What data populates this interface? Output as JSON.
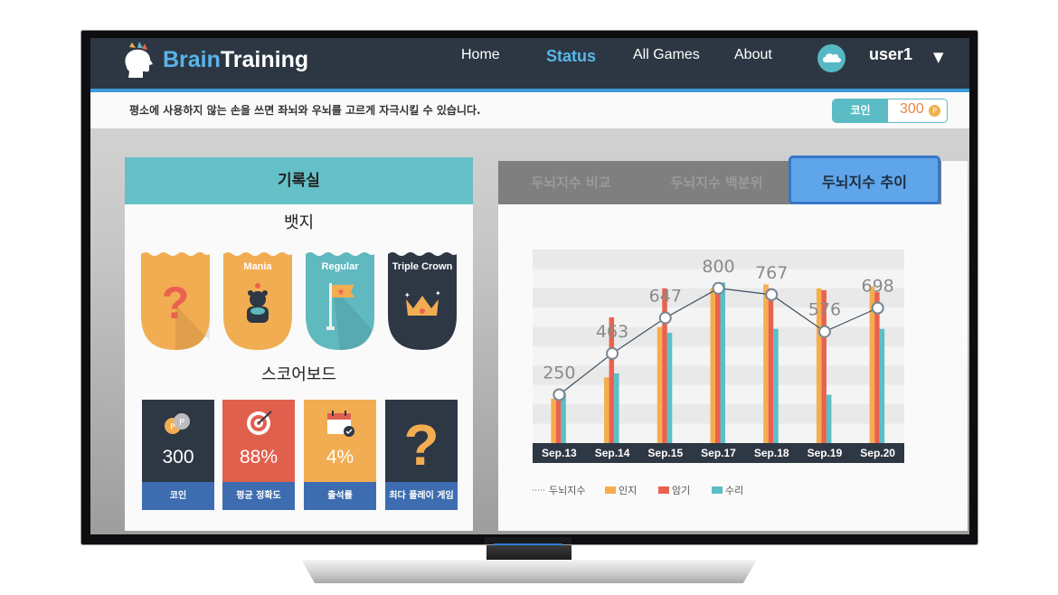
{
  "app": {
    "logo_part1": "Brain",
    "logo_part2": "Training"
  },
  "nav": {
    "items": [
      {
        "label": "Home"
      },
      {
        "label": "Status",
        "active": true
      },
      {
        "label": "All Games"
      },
      {
        "label": "About"
      }
    ],
    "username": "user1",
    "dropdown_glyph": "▼"
  },
  "infobar": {
    "message": "평소에 사용하지 않는 손을 쓰면 좌뇌와 우뇌를 고르게 자극시킬 수 있습니다.",
    "coin_label": "코인",
    "coin_value": "300",
    "coin_symbol": "P"
  },
  "records": {
    "title": "기록실",
    "badges_title": "뱃지",
    "badges": [
      {
        "label": "",
        "icon": "question-icon",
        "color": "#f2ad52"
      },
      {
        "label": "Mania",
        "icon": "bear-icon",
        "color": "#f2ad52"
      },
      {
        "label": "Regular",
        "icon": "flag-icon",
        "color": "#5fb9bf"
      },
      {
        "label": "Triple Crown",
        "icon": "crown-icon",
        "color": "#2e3744"
      }
    ],
    "scoreboard_title": "스코어보드",
    "scoreboard": [
      {
        "value": "300",
        "label": "코인",
        "icon": "coins-icon",
        "color": "#2e3744"
      },
      {
        "value": "88%",
        "label": "평균 정확도",
        "icon": "target-icon",
        "color": "#e0604e"
      },
      {
        "value": "4%",
        "label": "출석률",
        "icon": "calendar-icon",
        "color": "#f2ad52"
      },
      {
        "value": "",
        "label": "최다 플레이 게임",
        "icon": "question-icon",
        "color": "#2e3744"
      }
    ]
  },
  "tabs": [
    {
      "label": "두뇌지수 비교",
      "active": false
    },
    {
      "label": "두뇌지수 백분위",
      "active": false
    },
    {
      "label": "두뇌지수 추이",
      "active": true
    }
  ],
  "chart_data": {
    "type": "bar",
    "categories": [
      "Sep.13",
      "Sep.14",
      "Sep.15",
      "Sep.17",
      "Sep.18",
      "Sep.19",
      "Sep.20"
    ],
    "ylim": [
      0,
      1000
    ],
    "grid": true,
    "legend_position": "bottom",
    "series": [
      {
        "name": "인지",
        "type": "bar",
        "color": "#f6ad4c",
        "values": [
          230,
          340,
          600,
          800,
          820,
          800,
          810
        ]
      },
      {
        "name": "암기",
        "type": "bar",
        "color": "#e9624f",
        "values": [
          250,
          650,
          800,
          780,
          800,
          790,
          780
        ]
      },
      {
        "name": "수리",
        "type": "bar",
        "color": "#5bbfc7",
        "values": [
          260,
          360,
          570,
          830,
          590,
          250,
          590
        ]
      },
      {
        "name": "두뇌지수",
        "type": "line",
        "color": "#3f5060",
        "values": [
          250,
          463,
          647,
          800,
          767,
          576,
          698
        ]
      }
    ]
  }
}
